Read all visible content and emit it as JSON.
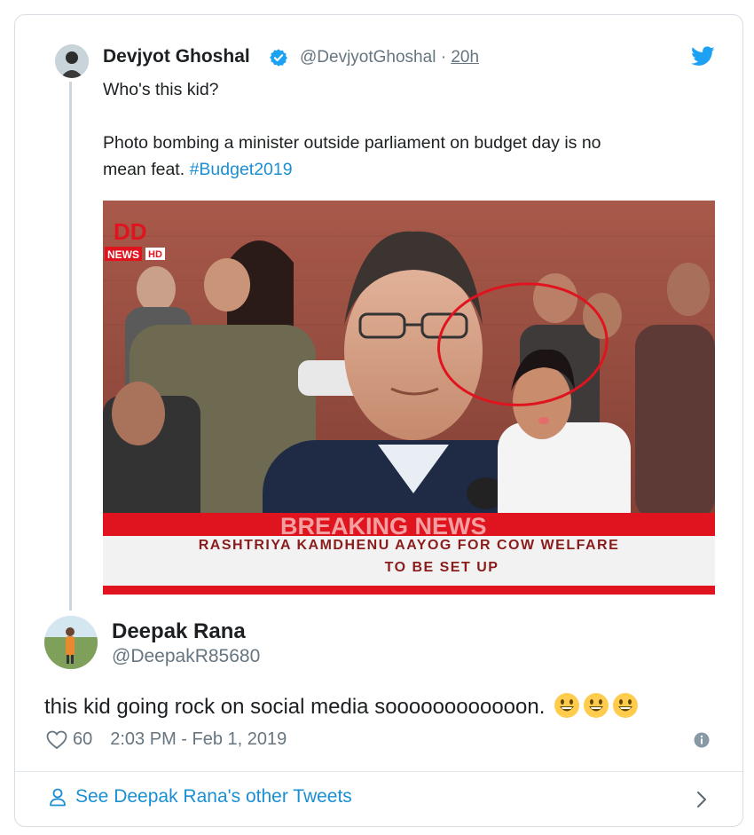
{
  "quoted_tweet": {
    "author_name": "Devjyot Ghoshal",
    "author_handle": "@DevjyotGhoshal",
    "separator": "·",
    "time": "20h",
    "line1": "Who's this kid?",
    "line2": "Photo bombing a minister outside parliament on budget day is no",
    "line3_prefix": "mean feat. ",
    "hashtag": "#Budget2019"
  },
  "media": {
    "channel_logo": "DD",
    "channel_sub": "NEWS",
    "channel_hd": "HD",
    "ticker_top": "BREAKING NEWS",
    "headline_line1": "RASHTRIYA KAMDHENU AAYOG FOR COW WELFARE",
    "headline_line2": "TO BE SET UP"
  },
  "tweet": {
    "author_name": "Deepak Rana",
    "author_handle": "@DeepakR85680",
    "text": "this kid going rock on social media soooooooooooon.",
    "emojis": [
      "grinning-face-emoji",
      "grinning-face-emoji",
      "grinning-face-emoji"
    ],
    "likes": "60",
    "timestamp": "2:03 PM - Feb 1, 2019"
  },
  "footer": {
    "link_label": "See Deepak Rana's other Tweets"
  },
  "colors": {
    "link_blue": "#1b8fd2",
    "twitter_blue": "#1da1f2",
    "verified_blue": "#1da1f2",
    "muted_gray": "#66757f",
    "news_red": "#e0141e"
  }
}
